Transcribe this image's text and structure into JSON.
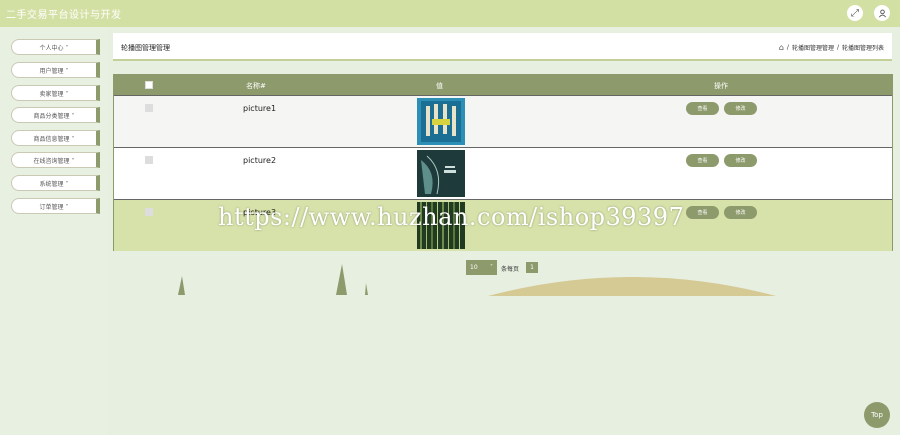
{
  "app": {
    "title": "二手交易平台设计与开发"
  },
  "topbar": {
    "fullscreen_icon": "expand-icon",
    "user_icon": "user-icon"
  },
  "sidebar": {
    "items": [
      {
        "label": "个人中心 ˅"
      },
      {
        "label": "用户管理 ˅"
      },
      {
        "label": "卖家管理 ˅"
      },
      {
        "label": "商品分类管理 ˅"
      },
      {
        "label": "商品信息管理 ˅"
      },
      {
        "label": "在线咨询管理 ˅"
      },
      {
        "label": "系统管理 ˅"
      },
      {
        "label": "订单管理 ˅"
      }
    ]
  },
  "header": {
    "title": "轮播图管理管理",
    "breadcrumb": [
      "轮播图管理管理",
      "轮播图管理列表"
    ],
    "separator": "/"
  },
  "table": {
    "columns": {
      "name": "名称#",
      "value": "值",
      "actions": "操作"
    },
    "rows": [
      {
        "name": "picture1",
        "thumb": "blue-poster",
        "view": "查看",
        "edit": "修改"
      },
      {
        "name": "picture2",
        "thumb": "dark-teal-poster",
        "view": "查看",
        "edit": "修改"
      },
      {
        "name": "picture3",
        "thumb": "green-forest-poster",
        "view": "查看",
        "edit": "修改"
      }
    ]
  },
  "pagination": {
    "page_size": "10",
    "per_page_label": "条每页",
    "current_page": "1"
  },
  "watermark": "https://www.huzhan.com/ishop39397",
  "to_top": "Top",
  "colors": {
    "accent": "#8d9a6b",
    "topbar": "#d3e0a4",
    "highlight_row": "#d6e2a9",
    "background": "#e6efe0"
  }
}
